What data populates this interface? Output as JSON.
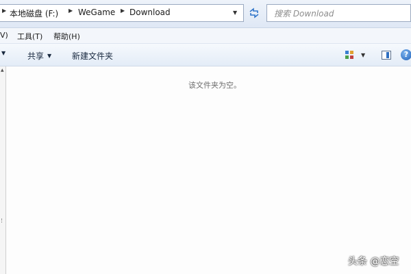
{
  "address": {
    "crumbs": [
      "本地磁盘 (F:)",
      "WeGame",
      "Download"
    ]
  },
  "search": {
    "placeholder": "搜索 Download"
  },
  "menu": {
    "items": [
      "V)",
      "工具(T)",
      "帮助(H)"
    ]
  },
  "toolbar": {
    "share_label": "共享",
    "new_folder_label": "新建文件夹"
  },
  "content": {
    "empty_message": "该文件夹为空。"
  },
  "watermark": {
    "text": "头条 @恋空"
  },
  "icons": {
    "breadcrumb_separator": "chevron-right-icon",
    "address_dropdown": "chevron-down-icon",
    "refresh": "refresh-icon",
    "views": "views-icon",
    "preview_pane": "preview-pane-icon",
    "help": "help-icon"
  },
  "colors": {
    "chrome_top": "#eef3fa",
    "toolbar_text": "#1a2a40",
    "placeholder": "#8c8c8c",
    "empty_text": "#6d6d6d"
  }
}
